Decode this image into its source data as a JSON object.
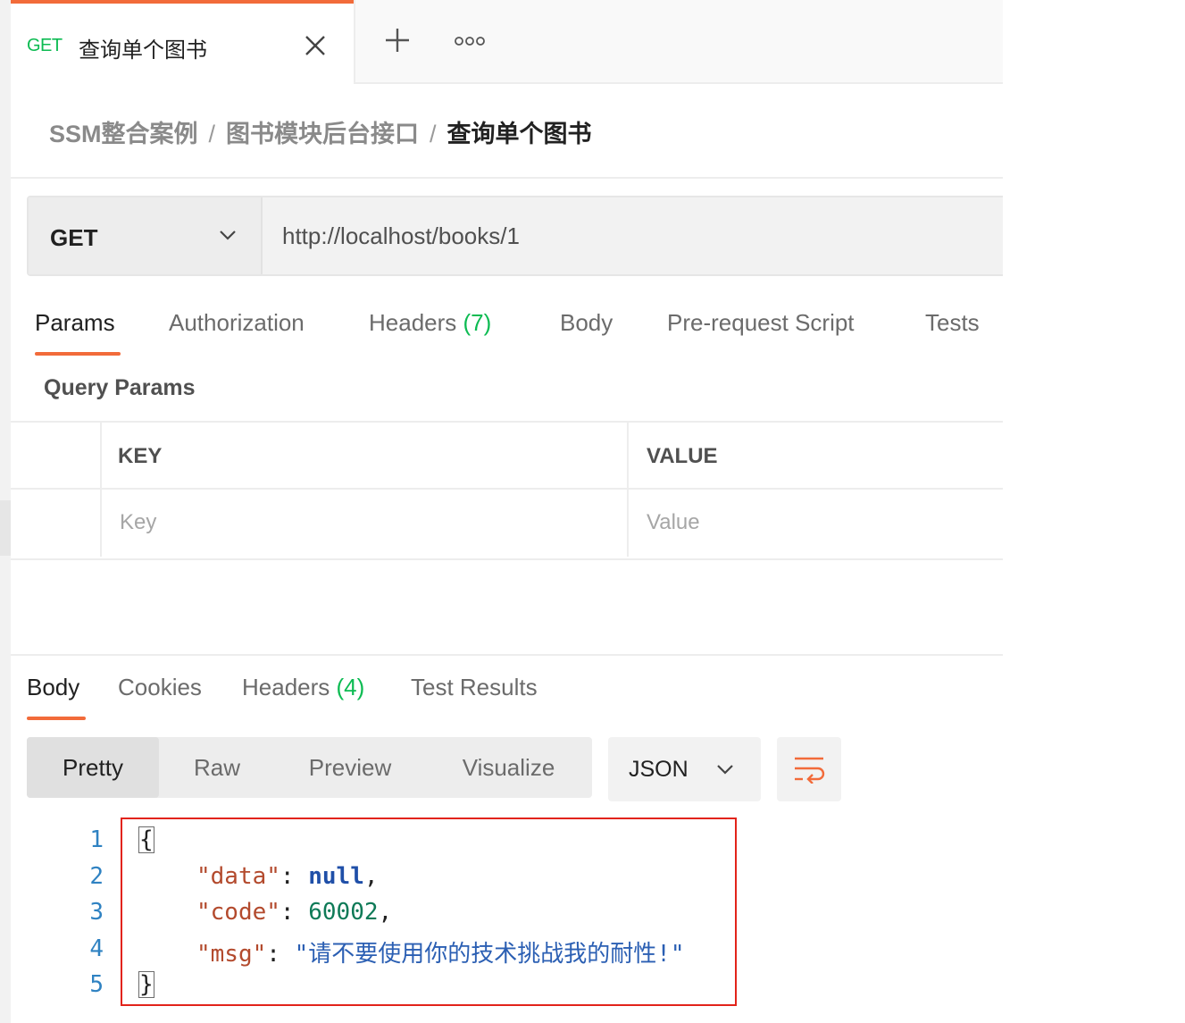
{
  "tab": {
    "method": "GET",
    "title": "查询单个图书",
    "close_icon": "close-icon",
    "new_tab_icon": "plus-icon",
    "more_icon": "more-icon",
    "accent_color": "#f26b3a"
  },
  "breadcrumb": {
    "items": [
      "SSM整合案例",
      "图书模块后台接口"
    ],
    "separator": "/",
    "current": "查询单个图书"
  },
  "request": {
    "method": "GET",
    "url": "http://localhost/books/1"
  },
  "request_tabs": [
    {
      "label": "Params",
      "active": true
    },
    {
      "label": "Authorization"
    },
    {
      "label": "Headers",
      "count": "(7)"
    },
    {
      "label": "Body"
    },
    {
      "label": "Pre-request Script"
    },
    {
      "label": "Tests"
    }
  ],
  "query_params": {
    "title": "Query Params",
    "key_header": "KEY",
    "value_header": "VALUE",
    "key_placeholder": "Key",
    "value_placeholder": "Value"
  },
  "response_tabs": [
    {
      "label": "Body",
      "active": true
    },
    {
      "label": "Cookies"
    },
    {
      "label": "Headers",
      "count": "(4)"
    },
    {
      "label": "Test Results"
    }
  ],
  "view_modes": [
    "Pretty",
    "Raw",
    "Preview",
    "Visualize"
  ],
  "active_view": "Pretty",
  "format": "JSON",
  "wrap_icon": "wrap-lines-icon",
  "response_body": {
    "line_numbers": [
      "1",
      "2",
      "3",
      "4",
      "5"
    ],
    "open_brace": "{",
    "close_brace": "}",
    "colon": ": ",
    "comma": ",",
    "data_key": "\"data\"",
    "data_value": "null",
    "code_key": "\"code\"",
    "code_value": "60002",
    "msg_key": "\"msg\"",
    "msg_value": "\"请不要使用你的技术挑战我的耐性!\""
  },
  "highlight_color": "#e2231a"
}
